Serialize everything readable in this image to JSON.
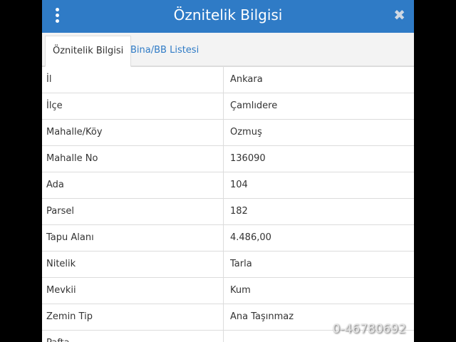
{
  "header": {
    "title": "Öznitelik Bilgisi",
    "close_glyph": "✖",
    "menu_icon": "vertical-dots"
  },
  "tabs": [
    {
      "label": "Öznitelik Bilgisi",
      "active": true
    },
    {
      "label": "Bina/BB Listesi",
      "active": false
    }
  ],
  "rows": [
    {
      "key": "İl",
      "value": "Ankara"
    },
    {
      "key": "İlçe",
      "value": "Çamlıdere"
    },
    {
      "key": "Mahalle/Köy",
      "value": "Ozmuş"
    },
    {
      "key": "Mahalle No",
      "value": "136090"
    },
    {
      "key": "Ada",
      "value": "104"
    },
    {
      "key": "Parsel",
      "value": "182"
    },
    {
      "key": "Tapu Alanı",
      "value": "4.486,00"
    },
    {
      "key": "Nitelik",
      "value": "Tarla"
    },
    {
      "key": "Mevkii",
      "value": "Kum"
    },
    {
      "key": "Zemin Tip",
      "value": "Ana Taşınmaz"
    },
    {
      "key": "Pafta",
      "value": "-"
    }
  ],
  "watermark": "0-46780692",
  "colors": {
    "accent": "#2f7bc6",
    "background": "#000000"
  }
}
